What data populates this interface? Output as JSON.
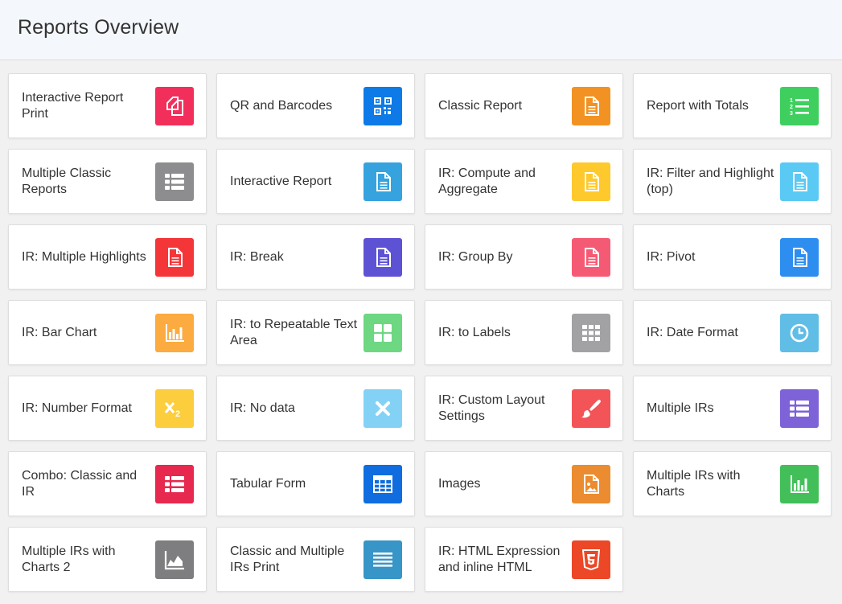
{
  "header": {
    "title": "Reports Overview"
  },
  "cards": [
    {
      "label": "Interactive Report Print",
      "icon": "copy-icon",
      "color": "#f22f5a"
    },
    {
      "label": "QR and Barcodes",
      "icon": "qr-code-icon",
      "color": "#0d7ae8"
    },
    {
      "label": "Classic Report",
      "icon": "document-icon",
      "color": "#f29222"
    },
    {
      "label": "Report with Totals",
      "icon": "numbered-list-icon",
      "color": "#3ecf5e"
    },
    {
      "label": "Multiple Classic Reports",
      "icon": "list-icon",
      "color": "#8d8d8f"
    },
    {
      "label": "Interactive Report",
      "icon": "document-icon",
      "color": "#36a3de"
    },
    {
      "label": "IR: Compute and Aggregate",
      "icon": "document-icon",
      "color": "#fec92d"
    },
    {
      "label": "IR: Filter and Highlight (top)",
      "icon": "document-icon",
      "color": "#5ac9f4"
    },
    {
      "label": "IR: Multiple Highlights",
      "icon": "document-icon",
      "color": "#f43639"
    },
    {
      "label": "IR: Break",
      "icon": "document-icon",
      "color": "#5e52d4"
    },
    {
      "label": "IR: Group By",
      "icon": "document-icon",
      "color": "#f55a74"
    },
    {
      "label": "IR: Pivot",
      "icon": "document-icon",
      "color": "#2d8ef0"
    },
    {
      "label": "IR: Bar Chart",
      "icon": "bar-chart-icon",
      "color": "#fbab3f"
    },
    {
      "label": "IR: to Repeatable Text Area",
      "icon": "grid-icon",
      "color": "#6dd782"
    },
    {
      "label": "IR: to Labels",
      "icon": "apps-icon",
      "color": "#a2a2a4"
    },
    {
      "label": "IR: Date Format",
      "icon": "clock-icon",
      "color": "#60bde5"
    },
    {
      "label": "IR: Number Format",
      "icon": "subscript-icon",
      "color": "#fccd3c"
    },
    {
      "label": "IR: No data",
      "icon": "close-icon",
      "color": "#83d2f6"
    },
    {
      "label": "IR: Custom Layout Settings",
      "icon": "brush-icon",
      "color": "#f35457"
    },
    {
      "label": "Multiple IRs",
      "icon": "list-icon",
      "color": "#7d62d8"
    },
    {
      "label": "Combo: Classic and IR",
      "icon": "list-icon",
      "color": "#e7284f"
    },
    {
      "label": "Tabular Form",
      "icon": "table-icon",
      "color": "#0f6ddf"
    },
    {
      "label": "Images",
      "icon": "image-file-icon",
      "color": "#ea8c2f"
    },
    {
      "label": "Multiple IRs with Charts",
      "icon": "bar-chart-icon",
      "color": "#43bf5a"
    },
    {
      "label": "Multiple IRs with Charts 2",
      "icon": "area-chart-icon",
      "color": "#7e7e80"
    },
    {
      "label": "Classic and Multiple IRs Print",
      "icon": "lines-icon",
      "color": "#3795c7"
    },
    {
      "label": "IR: HTML Expression and inline HTML",
      "icon": "html5-icon",
      "color": "#ec4727"
    }
  ]
}
